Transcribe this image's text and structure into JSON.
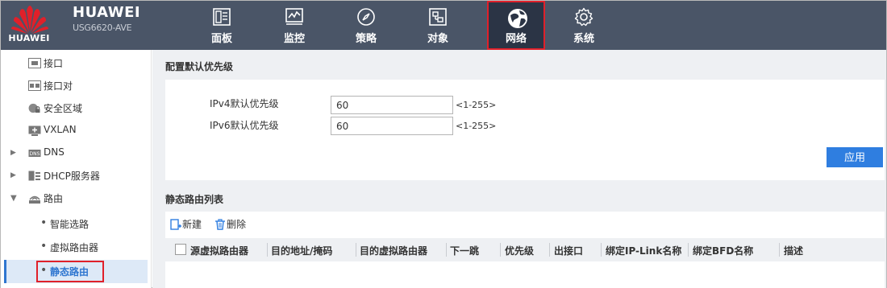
{
  "brand": {
    "logo_text": "HUAWEI",
    "name": "HUAWEI",
    "model": "USG6620-AVE"
  },
  "nav": [
    {
      "label": "面板",
      "icon": "dashboard-icon"
    },
    {
      "label": "监控",
      "icon": "monitor-icon"
    },
    {
      "label": "策略",
      "icon": "policy-compass-icon"
    },
    {
      "label": "对象",
      "icon": "object-icon"
    },
    {
      "label": "网络",
      "icon": "network-globe-icon",
      "active": true
    },
    {
      "label": "系统",
      "icon": "gear-icon"
    }
  ],
  "sidebar": {
    "items": [
      {
        "label": "接口",
        "icon": "interface-icon"
      },
      {
        "label": "接口对",
        "icon": "interface-pair-icon"
      },
      {
        "label": "安全区域",
        "icon": "security-zone-icon"
      },
      {
        "label": "VXLAN",
        "icon": "vxlan-icon"
      },
      {
        "label": "DNS",
        "icon": "dns-icon",
        "expandable": true
      },
      {
        "label": "DHCP服务器",
        "icon": "dhcp-server-icon",
        "expandable": true
      },
      {
        "label": "路由",
        "icon": "route-icon",
        "expanded": true
      },
      {
        "label": "智能选路",
        "child": true
      },
      {
        "label": "虚拟路由器",
        "child": true
      },
      {
        "label": "静态路由",
        "child": true,
        "selected": true
      }
    ]
  },
  "priority_section": {
    "title": "配置默认优先级",
    "ipv4_label": "IPv4默认优先级",
    "ipv4_value": "60",
    "ipv4_range": "<1-255>",
    "ipv6_label": "IPv6默认优先级",
    "ipv6_value": "60",
    "ipv6_range": "<1-255>",
    "apply_label": "应用"
  },
  "route_list": {
    "title": "静态路由列表",
    "new_label": "新建",
    "delete_label": "删除",
    "columns": [
      "源虚拟路由器",
      "目的地址/掩码",
      "目的虚拟路由器",
      "下一跳",
      "优先级",
      "出接口",
      "绑定IP-Link名称",
      "绑定BFD名称",
      "描述"
    ]
  },
  "colors": {
    "topbar": "#4a5567",
    "highlight": "#e0202a",
    "accent": "#2f7ee0",
    "logo_red": "#e0202a"
  }
}
